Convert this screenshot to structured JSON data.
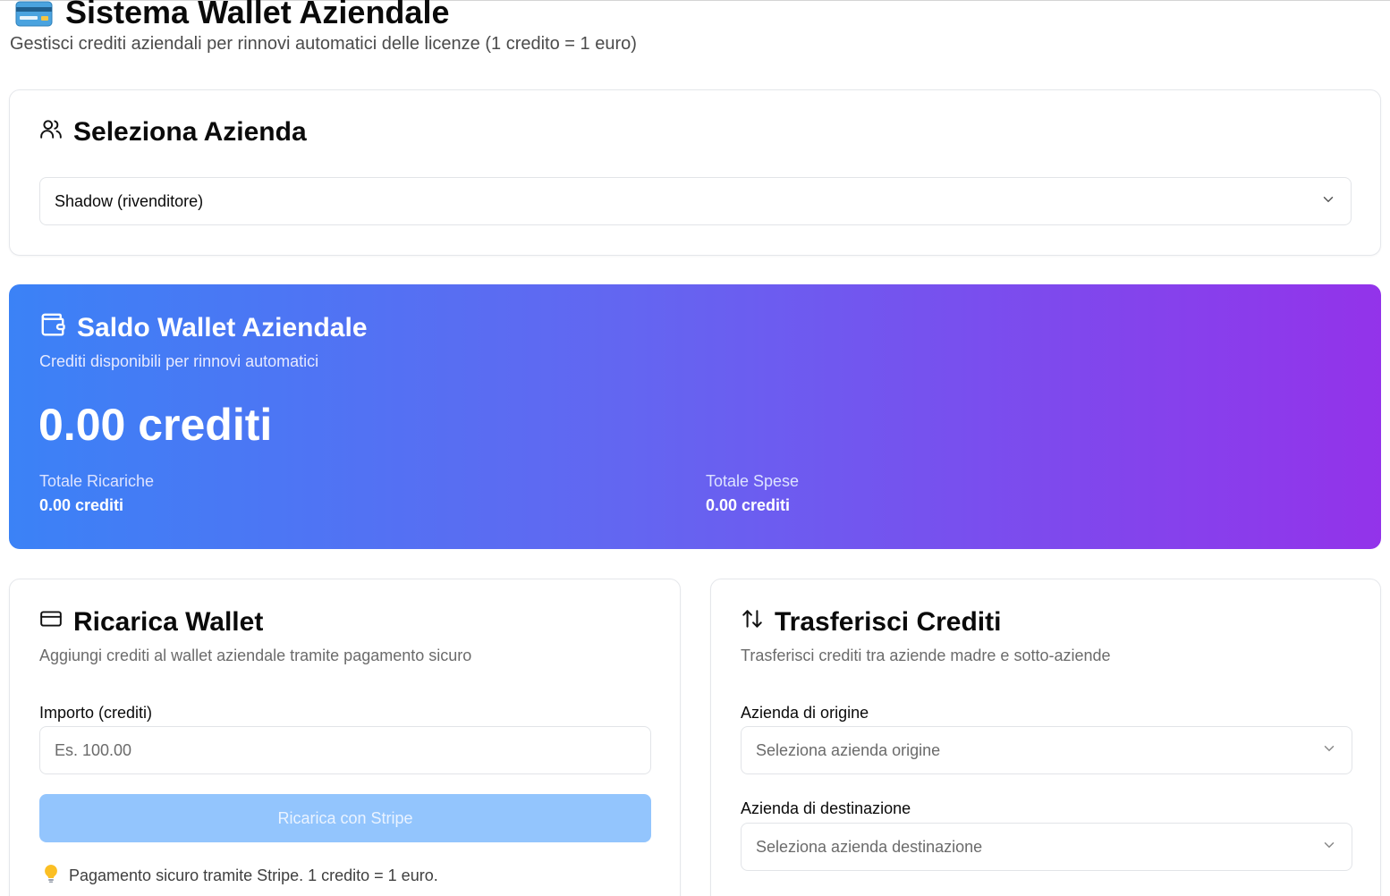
{
  "header": {
    "title": "Sistema Wallet Aziendale",
    "subtitle": "Gestisci crediti aziendali per rinnovi automatici delle licenze (1 credito = 1 euro)",
    "icon": "credit-card-emoji"
  },
  "company_select": {
    "heading": "Seleziona Azienda",
    "icon": "users-icon",
    "selected": "Shadow (rivenditore)"
  },
  "balance": {
    "heading": "Saldo Wallet Aziendale",
    "icon": "wallet-icon",
    "description": "Crediti disponibili per rinnovi automatici",
    "amount": "0.00 crediti",
    "total_recharges_label": "Totale Ricariche",
    "total_recharges_value": "0.00 crediti",
    "total_spent_label": "Totale Spese",
    "total_spent_value": "0.00 crediti",
    "gradient_start": "#3b82f6",
    "gradient_end": "#9333ea"
  },
  "recharge": {
    "heading": "Ricarica Wallet",
    "icon": "credit-card-icon",
    "description": "Aggiungi crediti al wallet aziendale tramite pagamento sicuro",
    "amount_label": "Importo (crediti)",
    "amount_placeholder": "Es. 100.00",
    "button_label": "Ricarica con Stripe",
    "note": "Pagamento sicuro tramite Stripe. 1 credito = 1 euro.",
    "note_icon": "lightbulb-icon"
  },
  "transfer": {
    "heading": "Trasferisci Crediti",
    "icon": "arrows-up-down-icon",
    "description": "Trasferisci crediti tra aziende madre e sotto-aziende",
    "origin_label": "Azienda di origine",
    "origin_placeholder": "Seleziona azienda origine",
    "destination_label": "Azienda di destinazione",
    "destination_placeholder": "Seleziona azienda destinazione"
  }
}
